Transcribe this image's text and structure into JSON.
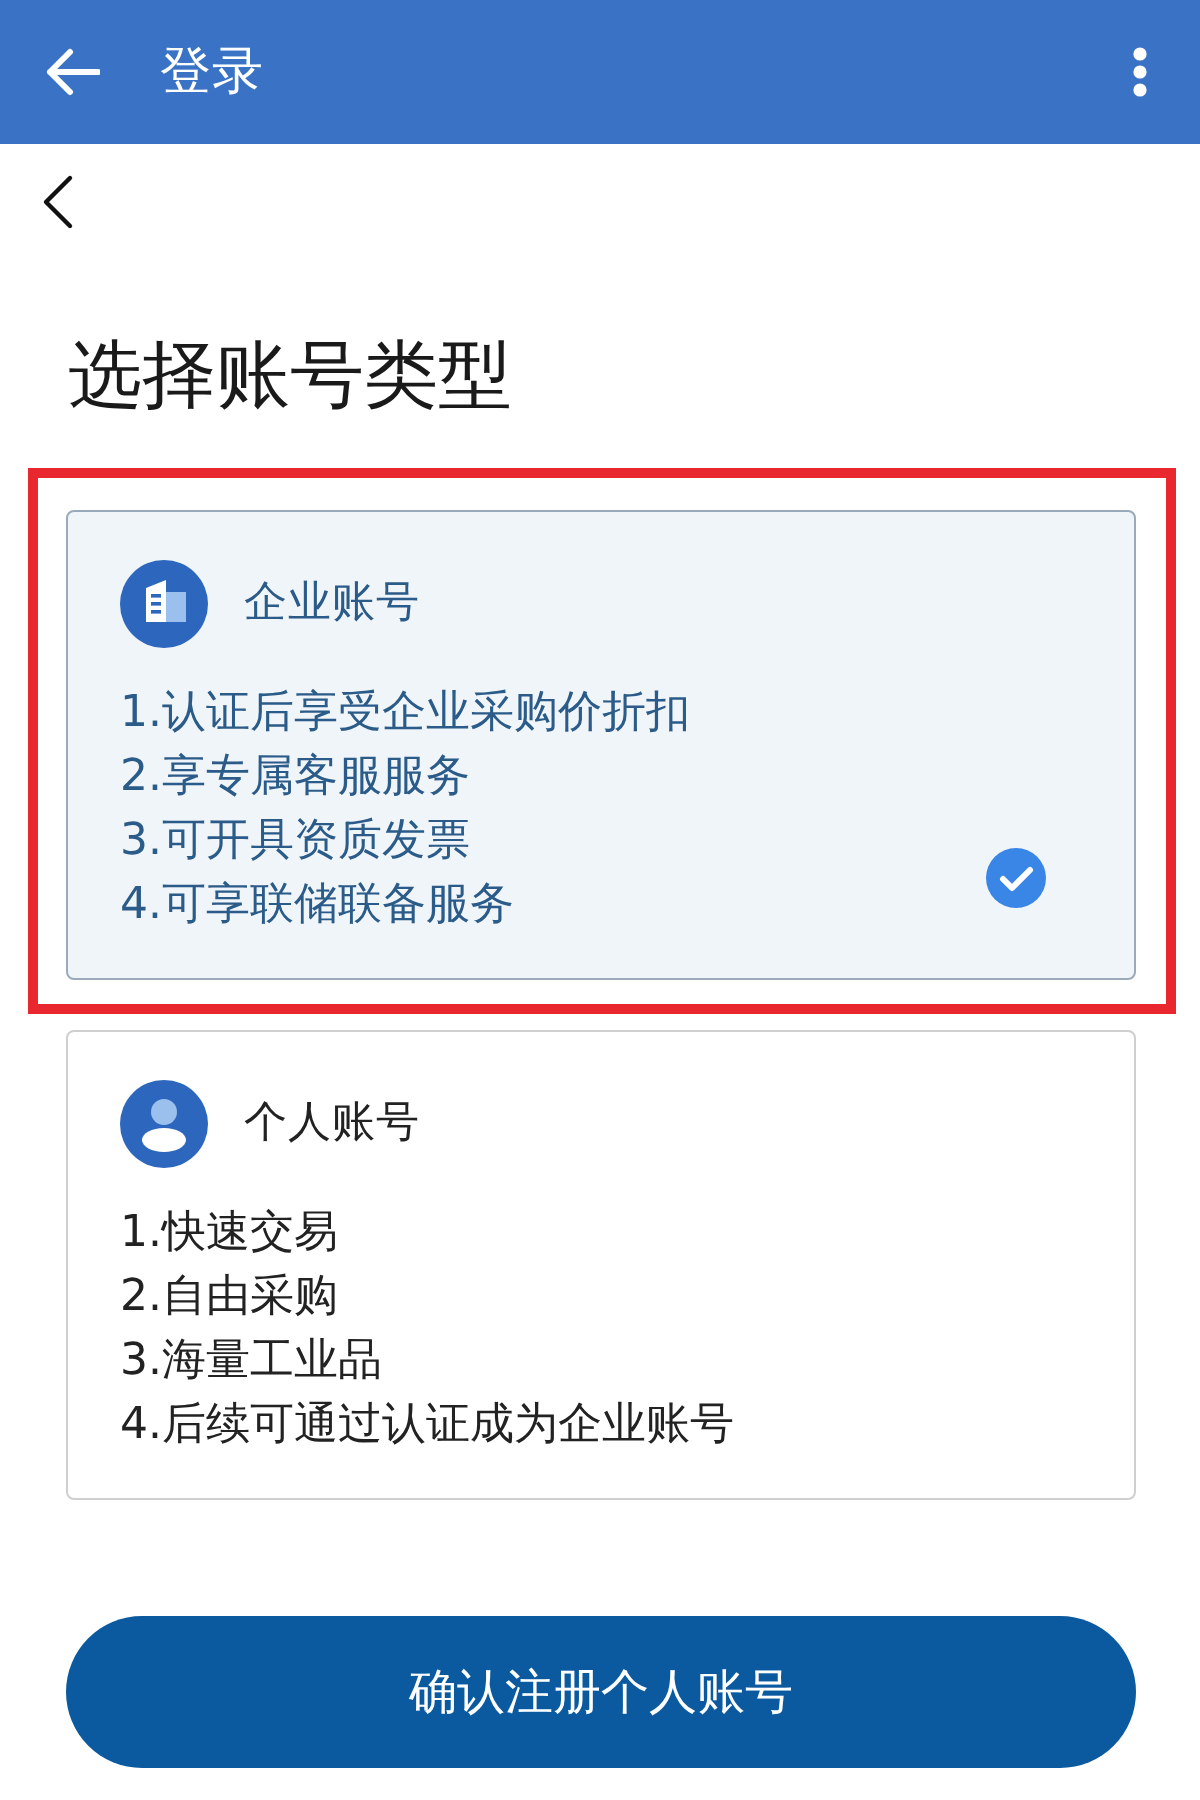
{
  "app_bar": {
    "title": "登录"
  },
  "page": {
    "title": "选择账号类型"
  },
  "account_types": [
    {
      "kind": "enterprise",
      "name": "企业账号",
      "selected": true,
      "highlighted": true,
      "benefits": [
        "1.认证后享受企业采购价折扣",
        "2.享专属客服服务",
        "3.可开具资质发票",
        "4.可享联储联备服务"
      ]
    },
    {
      "kind": "personal",
      "name": "个人账号",
      "selected": false,
      "highlighted": false,
      "benefits": [
        "1.快速交易",
        "2.自由采购",
        "3.海量工业品",
        "4.后续可通过认证成为企业账号"
      ]
    }
  ],
  "confirm_button": {
    "label": "确认注册个人账号"
  }
}
